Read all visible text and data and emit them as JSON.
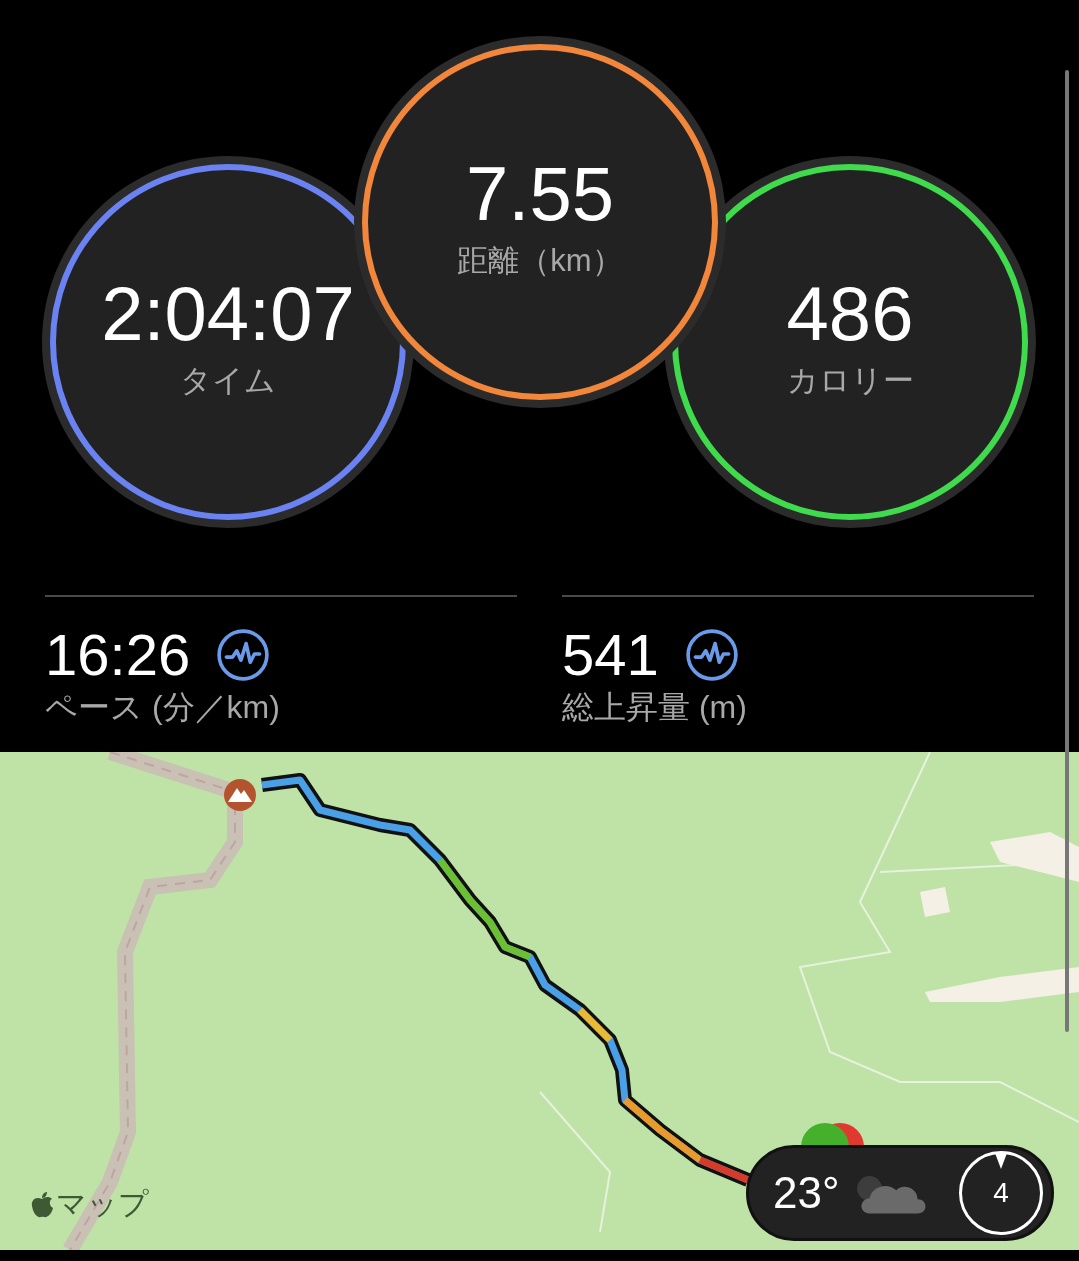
{
  "rings": [
    {
      "value": "2:04:07",
      "label": "タイム",
      "color": "#6b82f2"
    },
    {
      "value": "7.55",
      "label": "距離（km）",
      "color": "#f2873c"
    },
    {
      "value": "486",
      "label": "カロリー",
      "color": "#3fdb4c"
    }
  ],
  "metrics": [
    {
      "value": "16:26",
      "label": "ペース (分／km)"
    },
    {
      "value": "541",
      "label": "総上昇量 (m)"
    }
  ],
  "map": {
    "attribution": "マップ"
  },
  "weather": {
    "temperature": "23°",
    "wind": "4"
  }
}
